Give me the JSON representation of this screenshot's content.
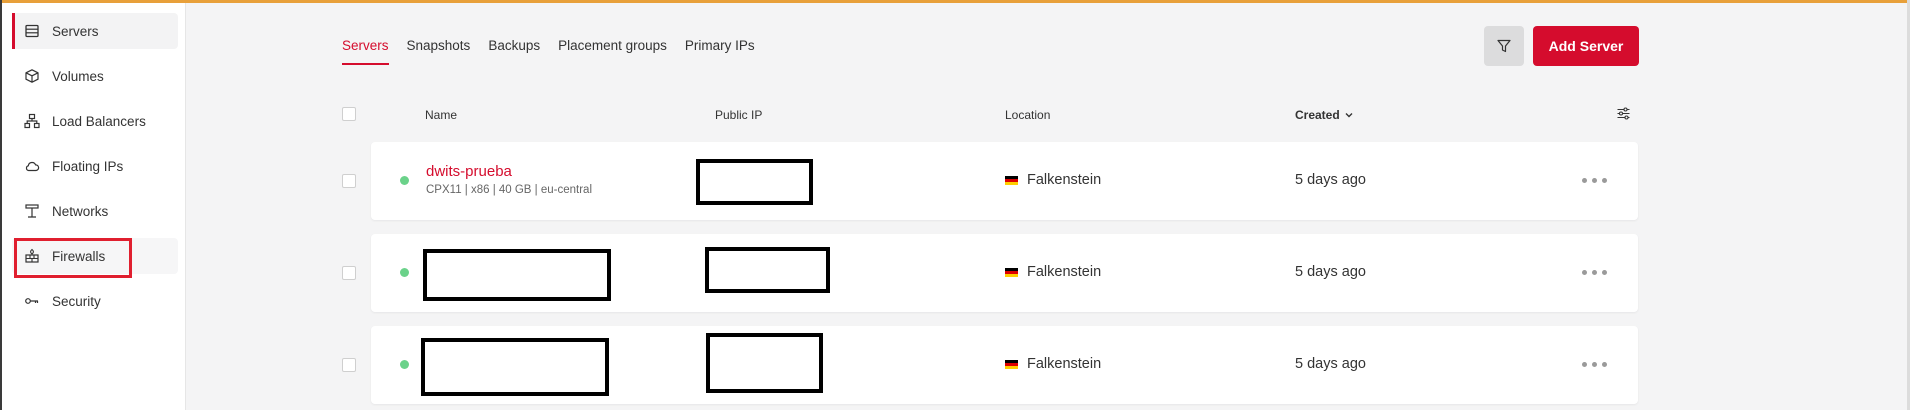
{
  "sidebar": {
    "items": [
      {
        "label": "Servers",
        "icon": "server-icon"
      },
      {
        "label": "Volumes",
        "icon": "cube-icon"
      },
      {
        "label": "Load Balancers",
        "icon": "load-balancer-icon"
      },
      {
        "label": "Floating IPs",
        "icon": "cloud-icon"
      },
      {
        "label": "Networks",
        "icon": "network-icon"
      },
      {
        "label": "Firewalls",
        "icon": "firewall-icon"
      },
      {
        "label": "Security",
        "icon": "key-icon"
      }
    ]
  },
  "tabs": [
    "Servers",
    "Snapshots",
    "Backups",
    "Placement groups",
    "Primary IPs"
  ],
  "toolbar": {
    "filter_icon": "filter-icon",
    "add_label": "Add Server"
  },
  "table": {
    "headers": {
      "name": "Name",
      "public_ip": "Public IP",
      "location": "Location",
      "created": "Created"
    },
    "rows": [
      {
        "name": "dwits-prueba",
        "meta": "CPX11 | x86 | 40 GB | eu-central",
        "location": "Falkenstein",
        "created": "5 days ago"
      },
      {
        "name": "",
        "meta": "",
        "location": "Falkenstein",
        "created": "5 days ago"
      },
      {
        "name": "",
        "meta": "",
        "location": "Falkenstein",
        "created": "5 days ago"
      }
    ]
  },
  "colors": {
    "accent": "#d50c2d",
    "status_running": "#6bd28a",
    "annotation": "#e01f2f"
  }
}
